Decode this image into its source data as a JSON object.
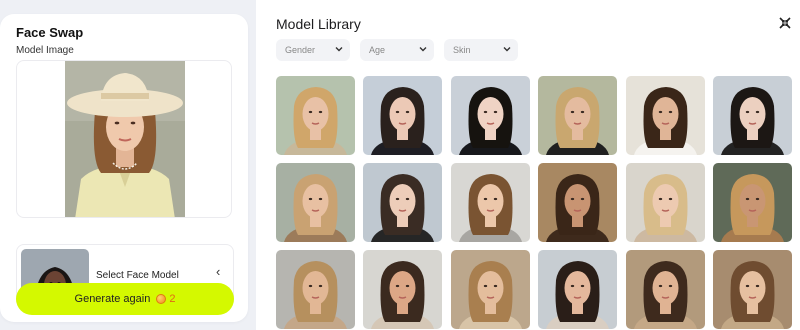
{
  "left": {
    "title": "Face Swap",
    "model_label": "Model Image",
    "select_label": "Select Face Model",
    "generate_label": "Generate again",
    "credits": "2",
    "accent": "#d4f900"
  },
  "library": {
    "title": "Model Library",
    "filters": [
      {
        "label": "Gender"
      },
      {
        "label": "Age"
      },
      {
        "label": "Skin"
      }
    ],
    "models": [
      {
        "name": "model-1",
        "bg": "#b5c2ad",
        "skin": "#e8c1a6",
        "hair": "#d0a66a",
        "cloth": "#c7b89a"
      },
      {
        "name": "model-2",
        "bg": "#c5ced8",
        "skin": "#ecc9b6",
        "hair": "#2a211d",
        "cloth": "#1e1e24"
      },
      {
        "name": "model-3",
        "bg": "#c9d0d8",
        "skin": "#efd3c4",
        "hair": "#16130f",
        "cloth": "#17181c"
      },
      {
        "name": "model-4",
        "bg": "#b4b89e",
        "skin": "#e4bb9f",
        "hair": "#c9a76f",
        "cloth": "#202020"
      },
      {
        "name": "model-5",
        "bg": "#e6e2d9",
        "skin": "#e0b597",
        "hair": "#3a2618",
        "cloth": "#f5f3ef"
      },
      {
        "name": "model-6",
        "bg": "#c8cfd6",
        "skin": "#ecd0c0",
        "hair": "#1c1714",
        "cloth": "#232323"
      },
      {
        "name": "model-7",
        "bg": "#a7b0a3",
        "skin": "#e8c0a2",
        "hair": "#c9a272",
        "cloth": "#9c7b5a"
      },
      {
        "name": "model-8",
        "bg": "#bfc8d0",
        "skin": "#edcdb9",
        "hair": "#3a2c24",
        "cloth": "#262626"
      },
      {
        "name": "model-9",
        "bg": "#d8d7d3",
        "skin": "#ecc7aa",
        "hair": "#7a5432",
        "cloth": "#a8a6a2"
      },
      {
        "name": "model-10",
        "bg": "#a88862",
        "skin": "#c89472",
        "hair": "#3a2618",
        "cloth": "#3e2a1c"
      },
      {
        "name": "model-11",
        "bg": "#d9d5cc",
        "skin": "#edcab1",
        "hair": "#d8bc8a",
        "cloth": "#cdb9a1"
      },
      {
        "name": "model-12",
        "bg": "#5f6a58",
        "skin": "#c99673",
        "hair": "#c6985c",
        "cloth": "#a67b4f"
      },
      {
        "name": "model-13",
        "bg": "#b6b5b0",
        "skin": "#e2b795",
        "hair": "#b6905e",
        "cloth": "#c4a789"
      },
      {
        "name": "model-14",
        "bg": "#d7d6d1",
        "skin": "#dca786",
        "hair": "#3b2a1f",
        "cloth": "#d5c7b6"
      },
      {
        "name": "model-15",
        "bg": "#bca78c",
        "skin": "#e4bd9c",
        "hair": "#a97f4f",
        "cloth": "#d8c4a7"
      },
      {
        "name": "model-16",
        "bg": "#c7cdd2",
        "skin": "#e4b89c",
        "hair": "#2a1e18",
        "cloth": "#d9cec2"
      },
      {
        "name": "model-17",
        "bg": "#b29a7c",
        "skin": "#e0b393",
        "hair": "#3e2a1d",
        "cloth": "#c5a887"
      },
      {
        "name": "model-18",
        "bg": "#a78c6f",
        "skin": "#e6c0a0",
        "hair": "#6f4c30",
        "cloth": "#c3a886"
      }
    ]
  }
}
